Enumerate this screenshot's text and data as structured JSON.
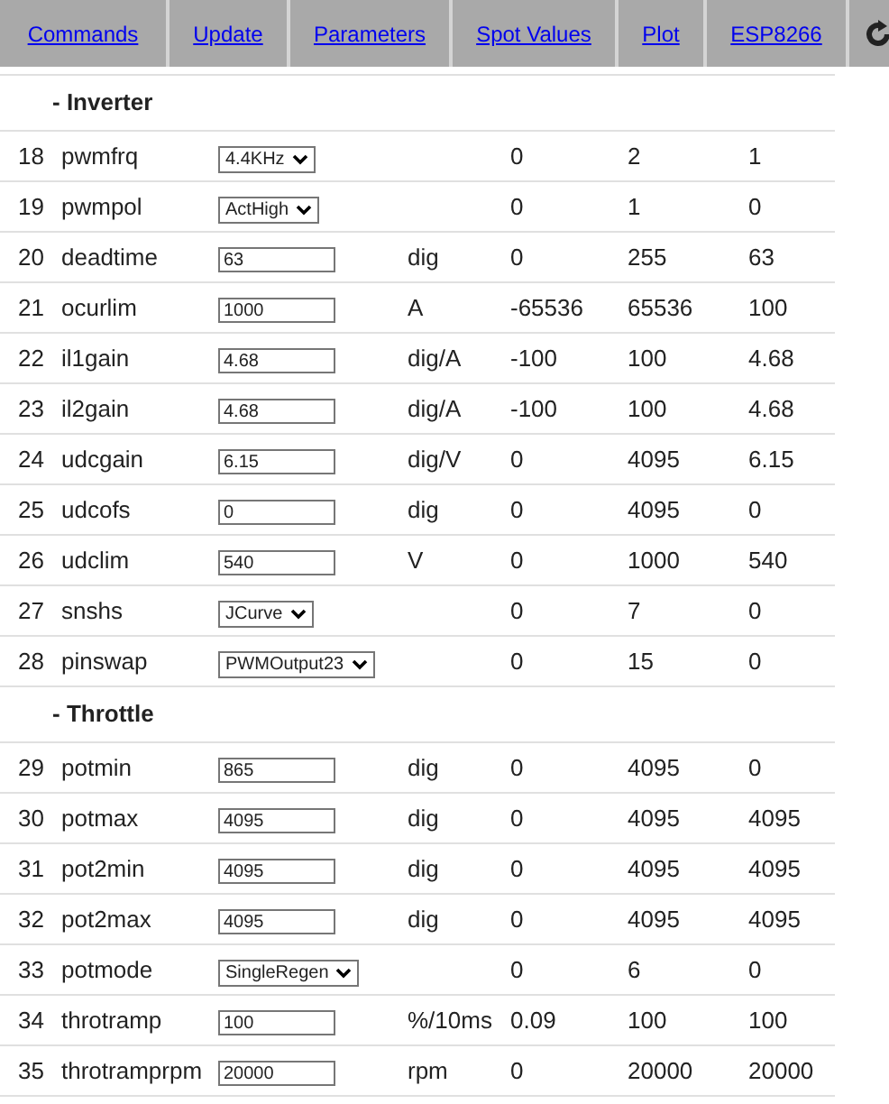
{
  "nav": {
    "tabs": [
      {
        "label": "Commands"
      },
      {
        "label": "Update"
      },
      {
        "label": "Parameters"
      },
      {
        "label": "Spot Values"
      },
      {
        "label": "Plot"
      },
      {
        "label": "ESP8266"
      }
    ]
  },
  "sections": [
    {
      "title": "- Inverter",
      "params": [
        {
          "id": "18",
          "name": "pwmfrq",
          "kind": "select",
          "value": "4.4KHz",
          "min": "0",
          "max": "2",
          "default": "1"
        },
        {
          "id": "19",
          "name": "pwmpol",
          "kind": "select",
          "value": "ActHigh",
          "min": "0",
          "max": "1",
          "default": "0"
        },
        {
          "id": "20",
          "name": "deadtime",
          "kind": "input",
          "value": "63",
          "unit": "dig",
          "min": "0",
          "max": "255",
          "default": "63"
        },
        {
          "id": "21",
          "name": "ocurlim",
          "kind": "input",
          "value": "1000",
          "unit": "A",
          "min": "-65536",
          "max": "65536",
          "default": "100"
        },
        {
          "id": "22",
          "name": "il1gain",
          "kind": "input",
          "value": "4.68",
          "unit": "dig/A",
          "min": "-100",
          "max": "100",
          "default": "4.68"
        },
        {
          "id": "23",
          "name": "il2gain",
          "kind": "input",
          "value": "4.68",
          "unit": "dig/A",
          "min": "-100",
          "max": "100",
          "default": "4.68"
        },
        {
          "id": "24",
          "name": "udcgain",
          "kind": "input",
          "value": "6.15",
          "unit": "dig/V",
          "min": "0",
          "max": "4095",
          "default": "6.15"
        },
        {
          "id": "25",
          "name": "udcofs",
          "kind": "input",
          "value": "0",
          "unit": "dig",
          "min": "0",
          "max": "4095",
          "default": "0"
        },
        {
          "id": "26",
          "name": "udclim",
          "kind": "input",
          "value": "540",
          "unit": "V",
          "min": "0",
          "max": "1000",
          "default": "540"
        },
        {
          "id": "27",
          "name": "snshs",
          "kind": "select",
          "value": "JCurve",
          "min": "0",
          "max": "7",
          "default": "0"
        },
        {
          "id": "28",
          "name": "pinswap",
          "kind": "select",
          "value": "PWMOutput23",
          "min": "0",
          "max": "15",
          "default": "0"
        }
      ]
    },
    {
      "title": "- Throttle",
      "params": [
        {
          "id": "29",
          "name": "potmin",
          "kind": "input",
          "value": "865",
          "unit": "dig",
          "min": "0",
          "max": "4095",
          "default": "0"
        },
        {
          "id": "30",
          "name": "potmax",
          "kind": "input",
          "value": "4095",
          "unit": "dig",
          "min": "0",
          "max": "4095",
          "default": "4095"
        },
        {
          "id": "31",
          "name": "pot2min",
          "kind": "input",
          "value": "4095",
          "unit": "dig",
          "min": "0",
          "max": "4095",
          "default": "4095"
        },
        {
          "id": "32",
          "name": "pot2max",
          "kind": "input",
          "value": "4095",
          "unit": "dig",
          "min": "0",
          "max": "4095",
          "default": "4095"
        },
        {
          "id": "33",
          "name": "potmode",
          "kind": "select",
          "value": "SingleRegen",
          "min": "0",
          "max": "6",
          "default": "0"
        },
        {
          "id": "34",
          "name": "throtramp",
          "kind": "input",
          "value": "100",
          "unit": "%/10ms",
          "min": "0.09",
          "max": "100",
          "default": "100"
        },
        {
          "id": "35",
          "name": "throtramprpm",
          "kind": "input",
          "value": "20000",
          "unit": "rpm",
          "min": "0",
          "max": "20000",
          "default": "20000"
        }
      ]
    }
  ]
}
